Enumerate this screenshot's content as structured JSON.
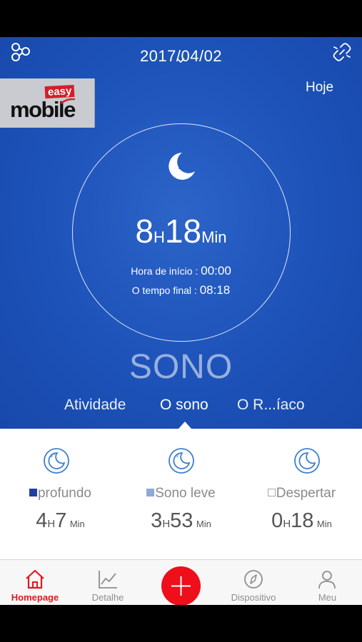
{
  "header": {
    "date": "2017/04/02",
    "today_label": "Hoje"
  },
  "logo": {
    "easy": "easy",
    "mobile": "mobile"
  },
  "summary": {
    "hours": "8",
    "hours_unit": "H",
    "minutes": "18",
    "minutes_unit": "Min",
    "start_label": "Hora de início : ",
    "start_value": "00:00",
    "end_label": "O tempo final : ",
    "end_value": "08:18",
    "title": "SONO"
  },
  "tabs": [
    {
      "label": "Atividade"
    },
    {
      "label": "O sono"
    },
    {
      "label": "O R...íaco"
    }
  ],
  "stats": [
    {
      "label": "profundo",
      "hours": "4",
      "minutes": "7",
      "color": "#1f3fa0"
    },
    {
      "label": "Sono leve",
      "hours": "3",
      "minutes": "53",
      "color": "#8fa8d4"
    },
    {
      "label": "Despertar",
      "hours": "0",
      "minutes": "18",
      "color": "#ffffff"
    }
  ],
  "units": {
    "h": "H",
    "min": "Min"
  },
  "nav": {
    "home": "Homepage",
    "detail": "Detalhe",
    "device": "Dispositivo",
    "me": "Meu"
  },
  "colors": {
    "accent": "#ee0f1b",
    "blue": "#1d52b8",
    "icon_blue": "#3f7fd0"
  },
  "icons": {
    "share": "share-icon",
    "unlink": "unlink-icon",
    "moon": "moon-icon",
    "home": "home-icon",
    "detail": "chart-line-icon",
    "add": "plus-icon",
    "device": "compass-icon",
    "me": "user-icon"
  }
}
